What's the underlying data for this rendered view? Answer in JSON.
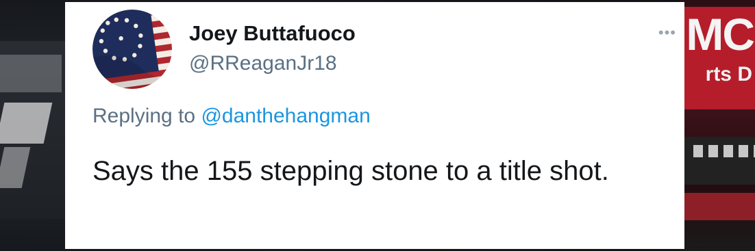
{
  "tweet": {
    "display_name": "Joey Buttafuoco",
    "handle": "@RReaganJr18",
    "replying_prefix": "Replying to",
    "replying_to": "@danthehangman",
    "text": "Says the 155 stepping stone to a title shot.",
    "more_icon": "ellipsis-icon",
    "avatar_icon": "betsy-ross-flag-icon"
  },
  "background": {
    "right_sign_text_1": "MC",
    "right_sign_text_2": "rts D"
  },
  "colors": {
    "card_bg": "#ffffff",
    "name": "#14171a",
    "secondary": "#5b7083",
    "mention": "#1b95e0",
    "sign_red": "#b51d2a"
  }
}
